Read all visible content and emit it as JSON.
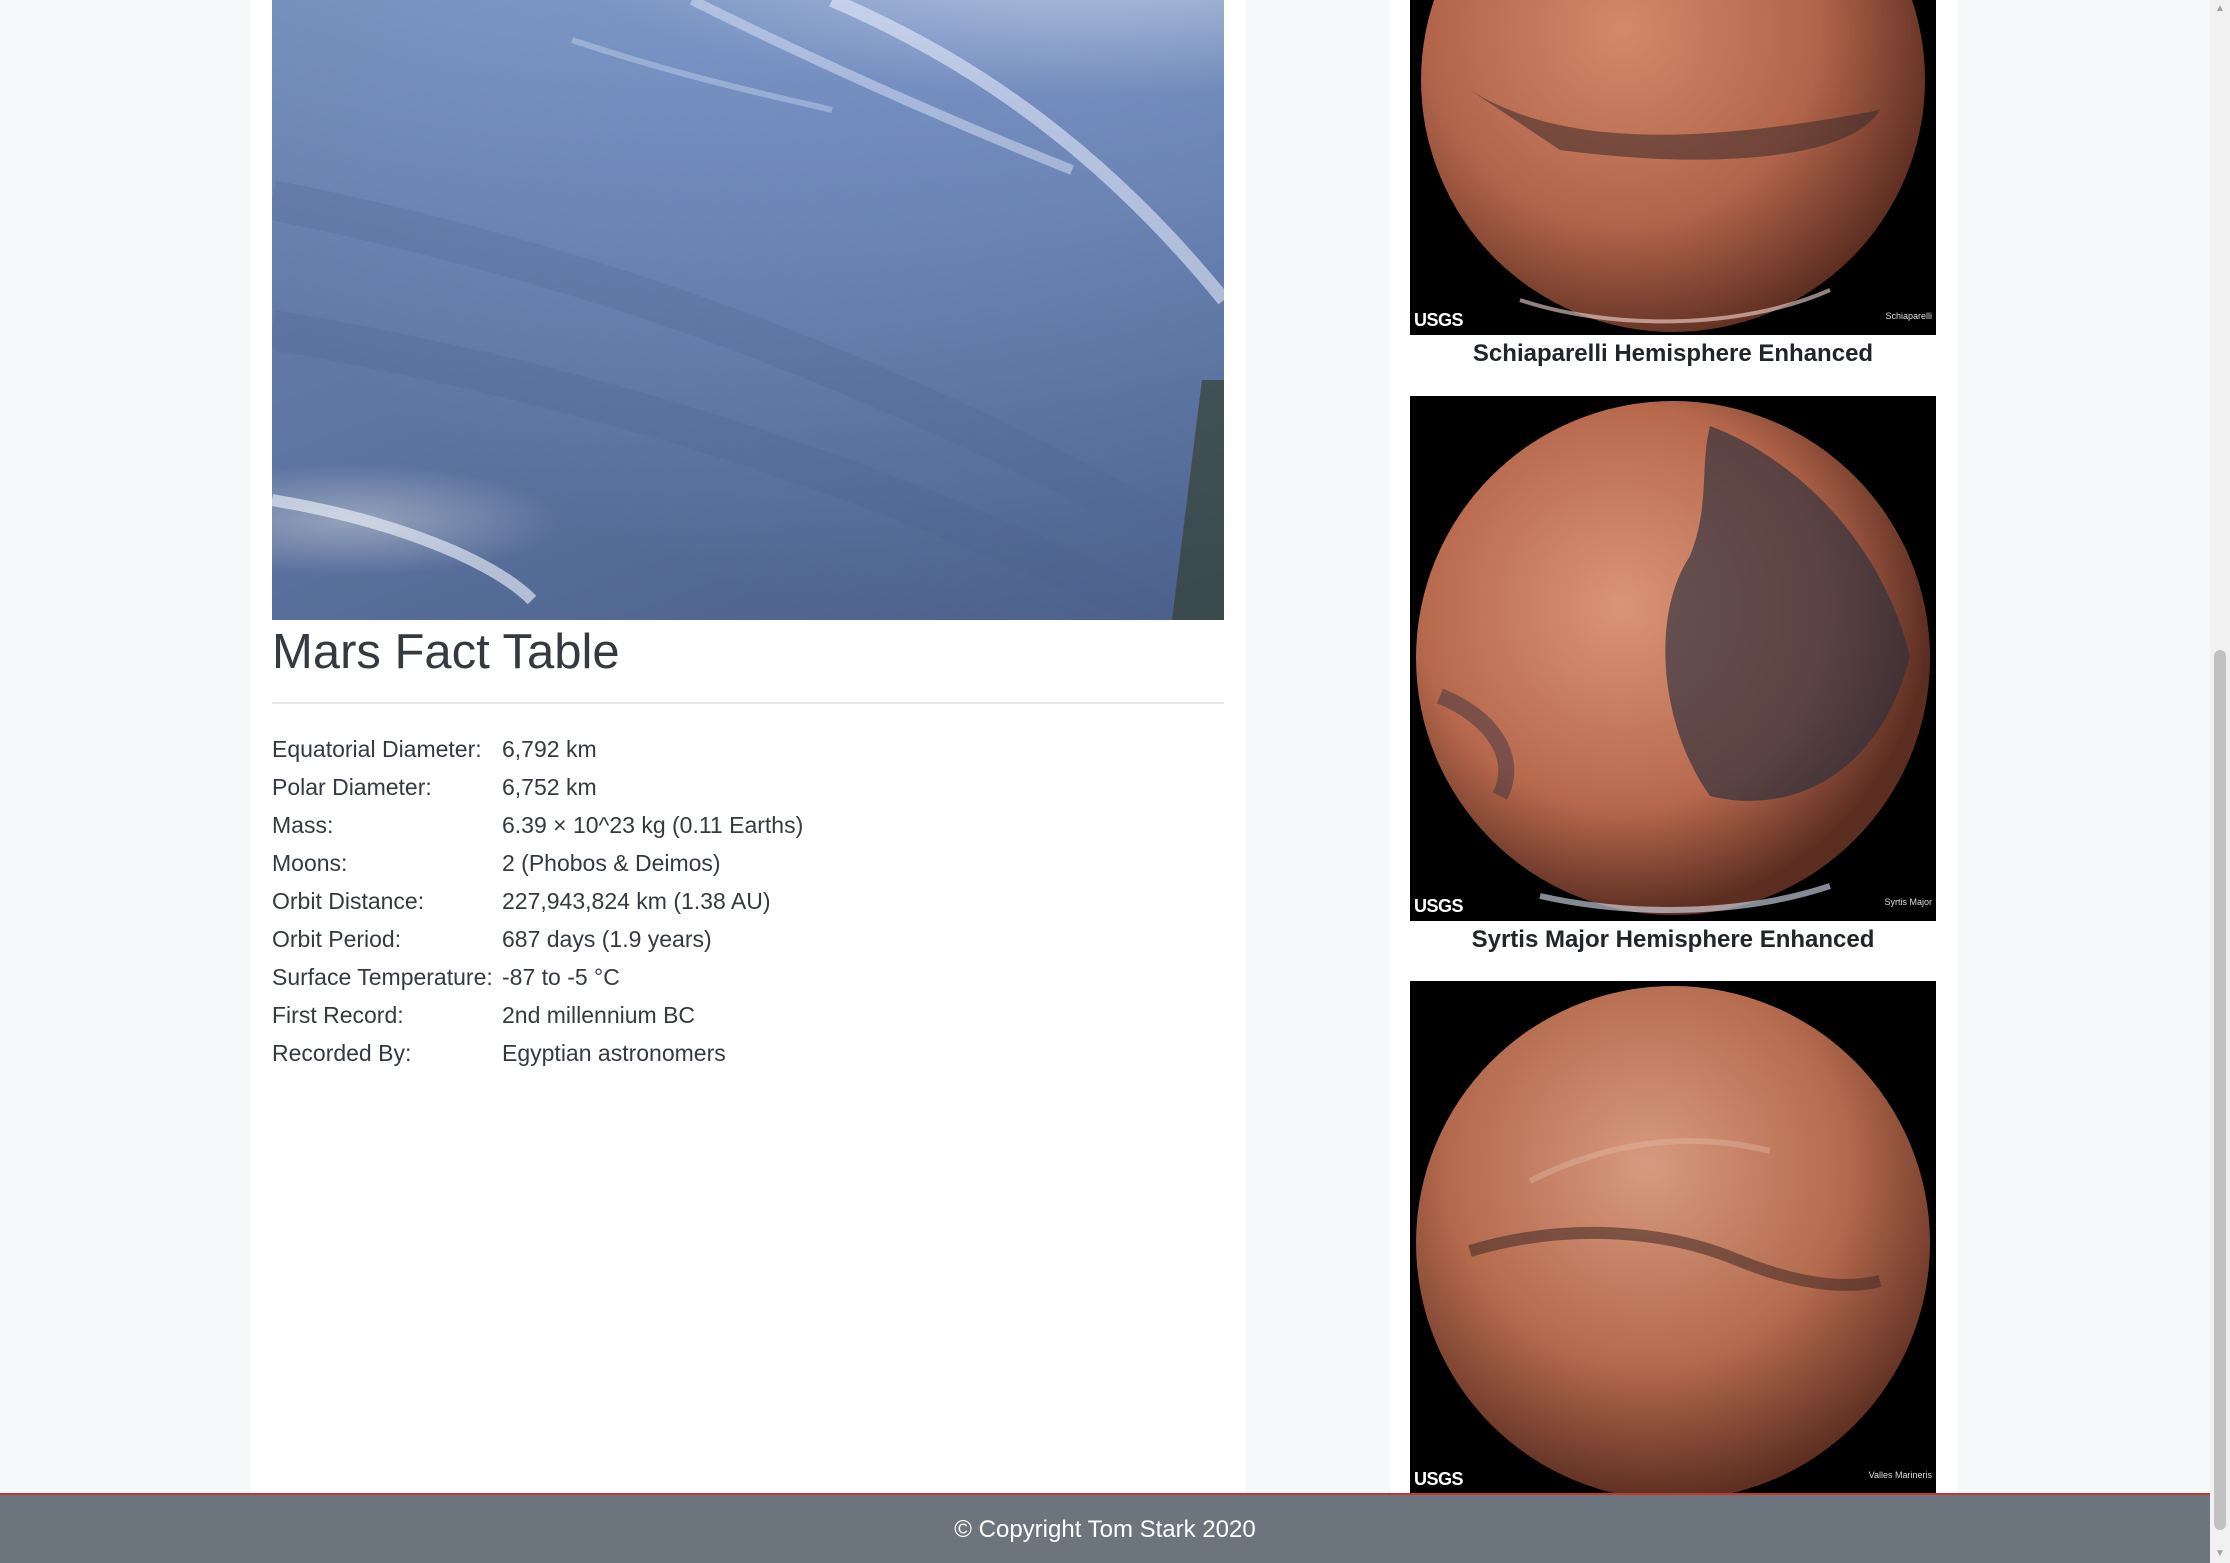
{
  "featured": {
    "image_alt": "Neptune atmosphere featured image"
  },
  "facts": {
    "title": "Mars Fact Table",
    "rows": [
      {
        "label": "Equatorial Diameter:",
        "value": "6,792 km"
      },
      {
        "label": "Polar Diameter:",
        "value": "6,752 km"
      },
      {
        "label": "Mass:",
        "value": "6.39 × 10^23 kg (0.11 Earths)"
      },
      {
        "label": "Moons:",
        "value": "2 (Phobos & Deimos)"
      },
      {
        "label": "Orbit Distance:",
        "value": "227,943,824 km (1.38 AU)"
      },
      {
        "label": "Orbit Period:",
        "value": "687 days (1.9 years)"
      },
      {
        "label": "Surface Temperature:",
        "value": "-87 to -5 °C"
      },
      {
        "label": "First Record:",
        "value": "2nd millennium BC"
      },
      {
        "label": "Recorded By:",
        "value": "Egyptian astronomers"
      }
    ]
  },
  "hemispheres": [
    {
      "caption": "Schiaparelli Hemisphere Enhanced",
      "logo": "USGS",
      "tag": "Schiaparelli"
    },
    {
      "caption": "Syrtis Major Hemisphere Enhanced",
      "logo": "USGS",
      "tag": "Syrtis Major"
    },
    {
      "caption": "",
      "logo": "USGS",
      "tag": "Valles Marineris"
    }
  ],
  "footer": {
    "text": "© Copyright Tom Stark 2020"
  }
}
